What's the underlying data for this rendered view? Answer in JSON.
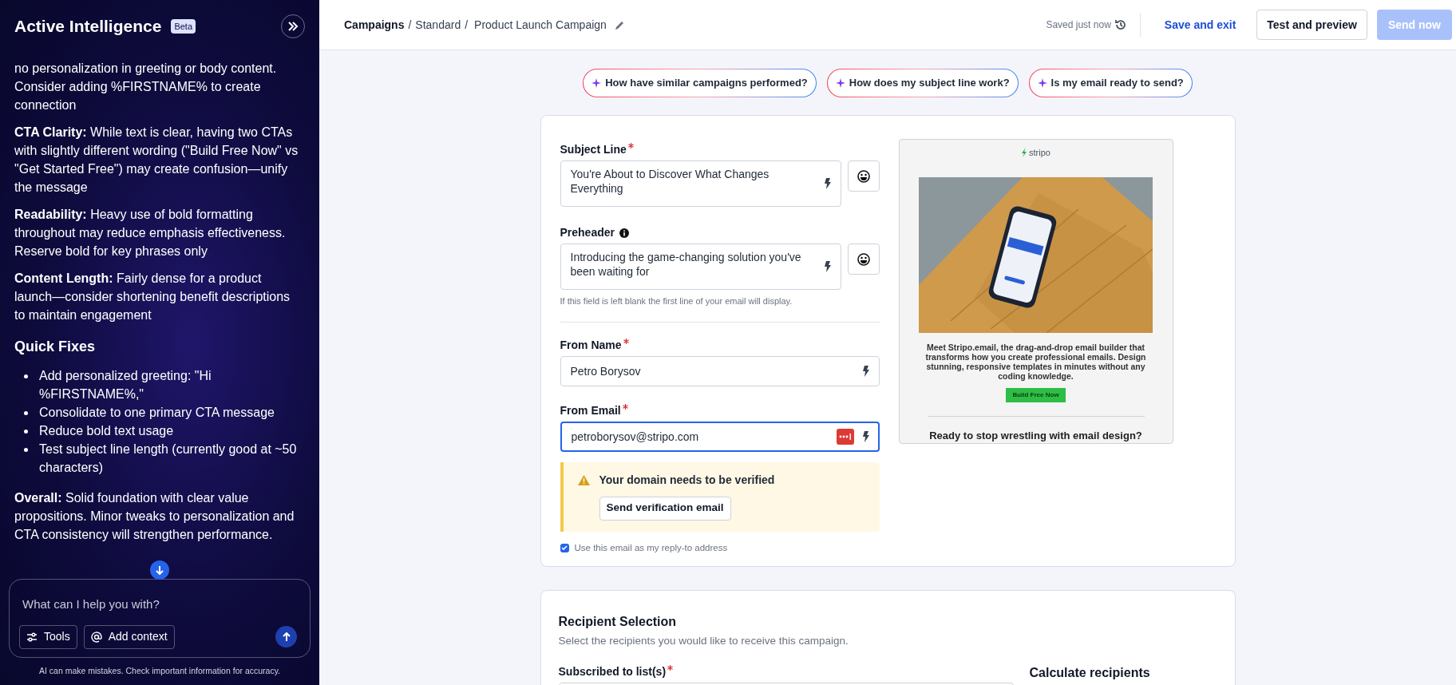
{
  "sidebar": {
    "title": "Active Intelligence",
    "badge": "Beta",
    "messages": [
      {
        "kind": "paragraph",
        "text": "no personalization in greeting or body content. Consider adding %FIRSTNAME% to create connection"
      },
      {
        "kind": "paragraph",
        "text": "**CTA Clarity:** While text is clear, having two CTAs with slightly different wording (\"Build Free Now\" vs \"Get Started Free\") may create confusion—unify the message"
      },
      {
        "kind": "paragraph",
        "text": "**Readability:** Heavy use of bold formatting throughout may reduce emphasis effectiveness. Reserve bold for key phrases only"
      },
      {
        "kind": "paragraph",
        "text": "**Content Length:** Fairly dense for a product launch—consider shortening benefit descriptions to maintain engagement"
      },
      {
        "kind": "heading",
        "text": "Quick Fixes"
      },
      {
        "kind": "list",
        "items": [
          "Add personalized greeting: \"Hi %FIRSTNAME%,\"",
          "Consolidate to one primary CTA message",
          "Reduce bold text usage",
          "Test subject line length (currently good at ~50 characters)"
        ]
      },
      {
        "kind": "paragraph",
        "text": "**Overall:** Solid foundation with clear value propositions. Minor tweaks to personalization and CTA consistency will strengthen performance."
      }
    ],
    "chat_input": {
      "placeholder": "What can I help you with?"
    },
    "tools_button": "Tools",
    "context_button": "Add context",
    "disclaimer": "AI can make mistakes. Check important information for accuracy."
  },
  "breadcrumb": {
    "items": [
      "Campaigns",
      "Standard"
    ],
    "separator": "/",
    "current": "Product Launch Campaign"
  },
  "save_status": "Saved just now",
  "actions": [
    {
      "label": "Save and exit",
      "kind": "link",
      "disabled": false
    },
    {
      "label": "Test and preview",
      "kind": "secondary",
      "disabled": false
    },
    {
      "label": "Send now",
      "kind": "primary",
      "disabled": true
    }
  ],
  "suggestions": [
    "How have similar campaigns performed?",
    "How does my subject line work?",
    "Is my email ready to send?"
  ],
  "campaign_form": {
    "subject": {
      "label": "Subject Line",
      "required": true,
      "value": "You're About to Discover What Changes Everything"
    },
    "preheader": {
      "label": "Preheader",
      "value": "Introducing the game-changing solution you've been waiting for",
      "hint": "If this field is left blank the first line of your email will display."
    },
    "from_name": {
      "label": "From Name",
      "required": true,
      "value": "Petro Borysov",
      "focused": false
    },
    "from_email": {
      "label": "From Email",
      "required": true,
      "value": "petroborysov@stripo.com",
      "focused": true
    },
    "warning": {
      "message": "Your domain needs to be verified",
      "button": "Send verification email"
    },
    "reply_to": {
      "label": "Use this email as my reply-to address",
      "checked": true
    }
  },
  "preview": {
    "logo": "stripo",
    "body": "Meet Stripo.email, the drag-and-drop email builder that transforms how you create professional emails. Design stunning, responsive templates in minutes without any coding knowledge.",
    "cta": "Build Free Now",
    "heading": "Ready to stop wrestling with email design?"
  },
  "recipients": {
    "title": "Recipient Selection",
    "subtitle": "Select the recipients you would like to receive this campaign.",
    "list_label": "Subscribed to list(s)",
    "list_required": true,
    "calculate_title": "Calculate recipients"
  }
}
